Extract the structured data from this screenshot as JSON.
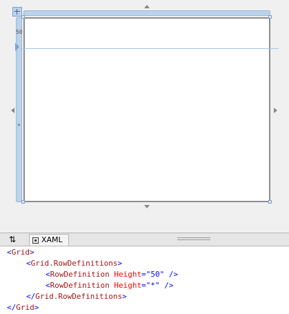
{
  "designer": {
    "row_labels": [
      "50",
      "*"
    ]
  },
  "tabs": {
    "swap_label": "⇅",
    "xaml_label": "XAML"
  },
  "code": {
    "lines": [
      {
        "open": "<",
        "tag": "Grid",
        "close": ">"
      },
      {
        "open": "<",
        "tag": "Grid.RowDefinitions",
        "close": ">"
      },
      {
        "open": "<",
        "tag": "RowDefinition",
        "attr": " Height",
        "eq": "=",
        "value": "\"50\"",
        "close": " />"
      },
      {
        "open": "<",
        "tag": "RowDefinition",
        "attr": " Height",
        "eq": "=",
        "value": "\"*\"",
        "close": " />"
      },
      {
        "open": "</",
        "tag": "Grid.RowDefinitions",
        "close": ">"
      },
      {
        "open": "</",
        "tag": "Grid",
        "close": ">"
      }
    ]
  }
}
